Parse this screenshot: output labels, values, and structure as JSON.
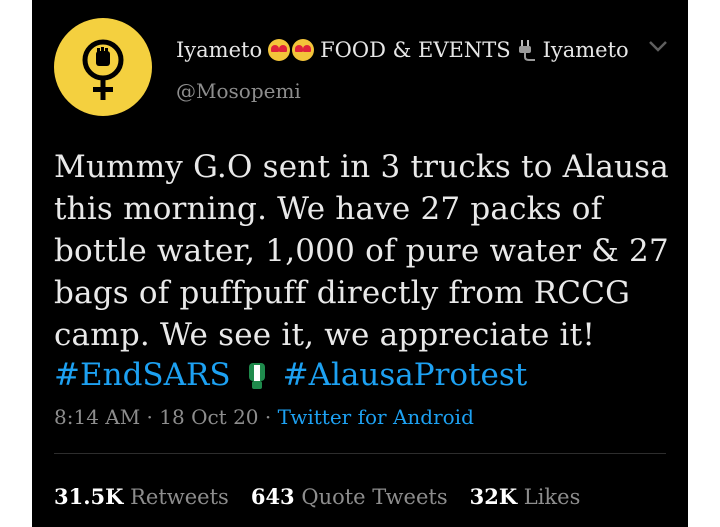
{
  "tweet": {
    "display_name": "Iyameto",
    "display_name_middle": "FOOD & EVENTS",
    "display_name_end": "Iyameto",
    "handle": "@Mosopemi",
    "text_lines": [
      "Mummy G.O sent in 3 trucks to Alausa",
      "this morning. We have 27 packs of",
      "bottle water, 1,000 of pure water & 27",
      "bags of puffpuff directly from RCCG",
      "camp. We see it, we appreciate it!"
    ],
    "hashtags": [
      "#EndSARS",
      "#AlausaProtest"
    ],
    "time": "8:14 AM",
    "date": "18 Oct 20",
    "source": "Twitter for Android",
    "separator": " · ",
    "stats": {
      "retweets_count": "31.5K",
      "retweets_label": "Retweets",
      "quotes_count": "643",
      "quotes_label": "Quote Tweets",
      "likes_count": "32K",
      "likes_label": "Likes"
    }
  },
  "colors": {
    "background": "#000000",
    "avatar": "#f4d03f",
    "link": "#1da1f2",
    "muted": "#8d8d8d"
  },
  "icons": [
    "female-fist-symbol-icon",
    "heart-eyes-emoji-icon",
    "plug-icon",
    "chevron-down-icon",
    "raised-fist-icon"
  ]
}
